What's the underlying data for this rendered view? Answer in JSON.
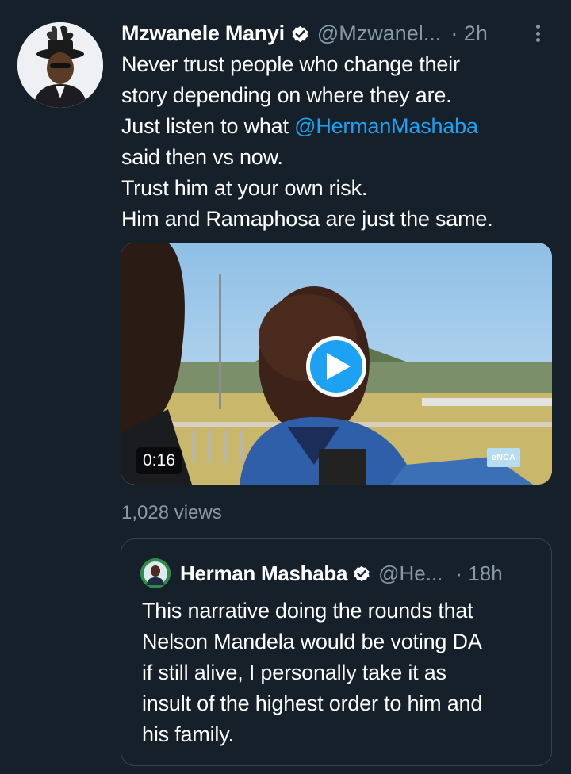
{
  "tweet": {
    "author": {
      "name": "Mzwanele Manyi",
      "handle": "@Mzwanel...",
      "time": "· 2h",
      "verified": true
    },
    "text_lines": [
      "Never trust people who change their",
      "story depending on where they are.",
      "Just listen to what ",
      "said then vs now.",
      "Trust him at your own risk.",
      "Him and Ramaphosa are just the same."
    ],
    "mention": "@HermanMashaba",
    "media": {
      "type": "video",
      "duration": "0:16",
      "channel_logo": "eNCA"
    },
    "views": "1,028 views"
  },
  "quoted_tweet": {
    "author": {
      "name": "Herman Mashaba",
      "handle": "@He...",
      "time": "· 18h",
      "verified": true
    },
    "text_lines": [
      "This narrative doing the rounds that",
      "Nelson Mandela would be voting DA",
      "if still alive, I personally take it as",
      "insult of the highest order to him and",
      "his family."
    ]
  },
  "colors": {
    "background": "#15202b",
    "text_primary": "#ffffff",
    "text_secondary": "#8899a6",
    "accent": "#1da1f2",
    "border": "#38444d"
  },
  "icons": {
    "verified": "verified-badge-icon",
    "more": "more-vertical-icon",
    "play": "play-icon"
  }
}
